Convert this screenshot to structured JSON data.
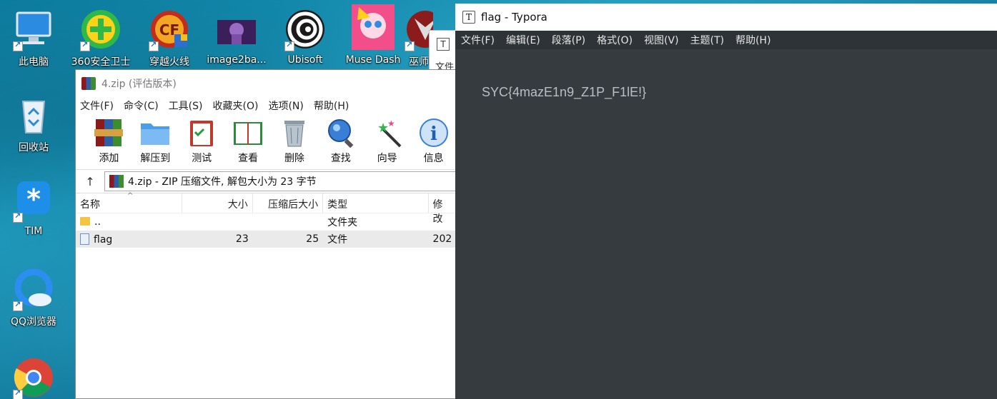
{
  "desktop": {
    "icons": [
      {
        "label": "此电脑",
        "icon": "computer-icon"
      },
      {
        "label": "360安全卫士",
        "icon": "360-icon"
      },
      {
        "label": "穿越火线",
        "icon": "crossfire-icon"
      },
      {
        "label": "image2ba...",
        "icon": "image-icon"
      },
      {
        "label": "Ubisoft",
        "icon": "ubisoft-icon"
      },
      {
        "label": "Muse Dash",
        "icon": "musedash-icon"
      },
      {
        "label": "巫师",
        "icon": "witcher-icon"
      },
      {
        "label": "回收站",
        "icon": "recycle-bin-icon"
      },
      {
        "label": "TIM",
        "icon": "tim-icon"
      },
      {
        "label": "QQ浏览器",
        "icon": "qq-browser-icon"
      },
      {
        "label": "",
        "icon": "chrome-icon"
      }
    ],
    "small_window_text": "文件"
  },
  "winrar": {
    "title": "4.zip (评估版本)",
    "menu": [
      "文件(F)",
      "命令(C)",
      "工具(S)",
      "收藏夹(O)",
      "选项(N)",
      "帮助(H)"
    ],
    "tools": [
      "添加",
      "解压到",
      "测试",
      "查看",
      "删除",
      "查找",
      "向导",
      "信息"
    ],
    "address": "4.zip - ZIP 压缩文件, 解包大小为 23 字节",
    "columns": [
      "名称",
      "大小",
      "压缩后大小",
      "类型",
      "修改"
    ],
    "rows": [
      {
        "name": "..",
        "size": "",
        "packed": "",
        "type": "文件夹",
        "modified": ""
      },
      {
        "name": "flag",
        "size": "23",
        "packed": "25",
        "type": "文件",
        "modified": "202"
      }
    ]
  },
  "typora": {
    "title": "flag - Typora",
    "menu": [
      "文件(F)",
      "编辑(E)",
      "段落(P)",
      "格式(O)",
      "视图(V)",
      "主题(T)",
      "帮助(H)"
    ],
    "content": "SYC{4mazE1n9_Z1P_F1lE!}"
  }
}
